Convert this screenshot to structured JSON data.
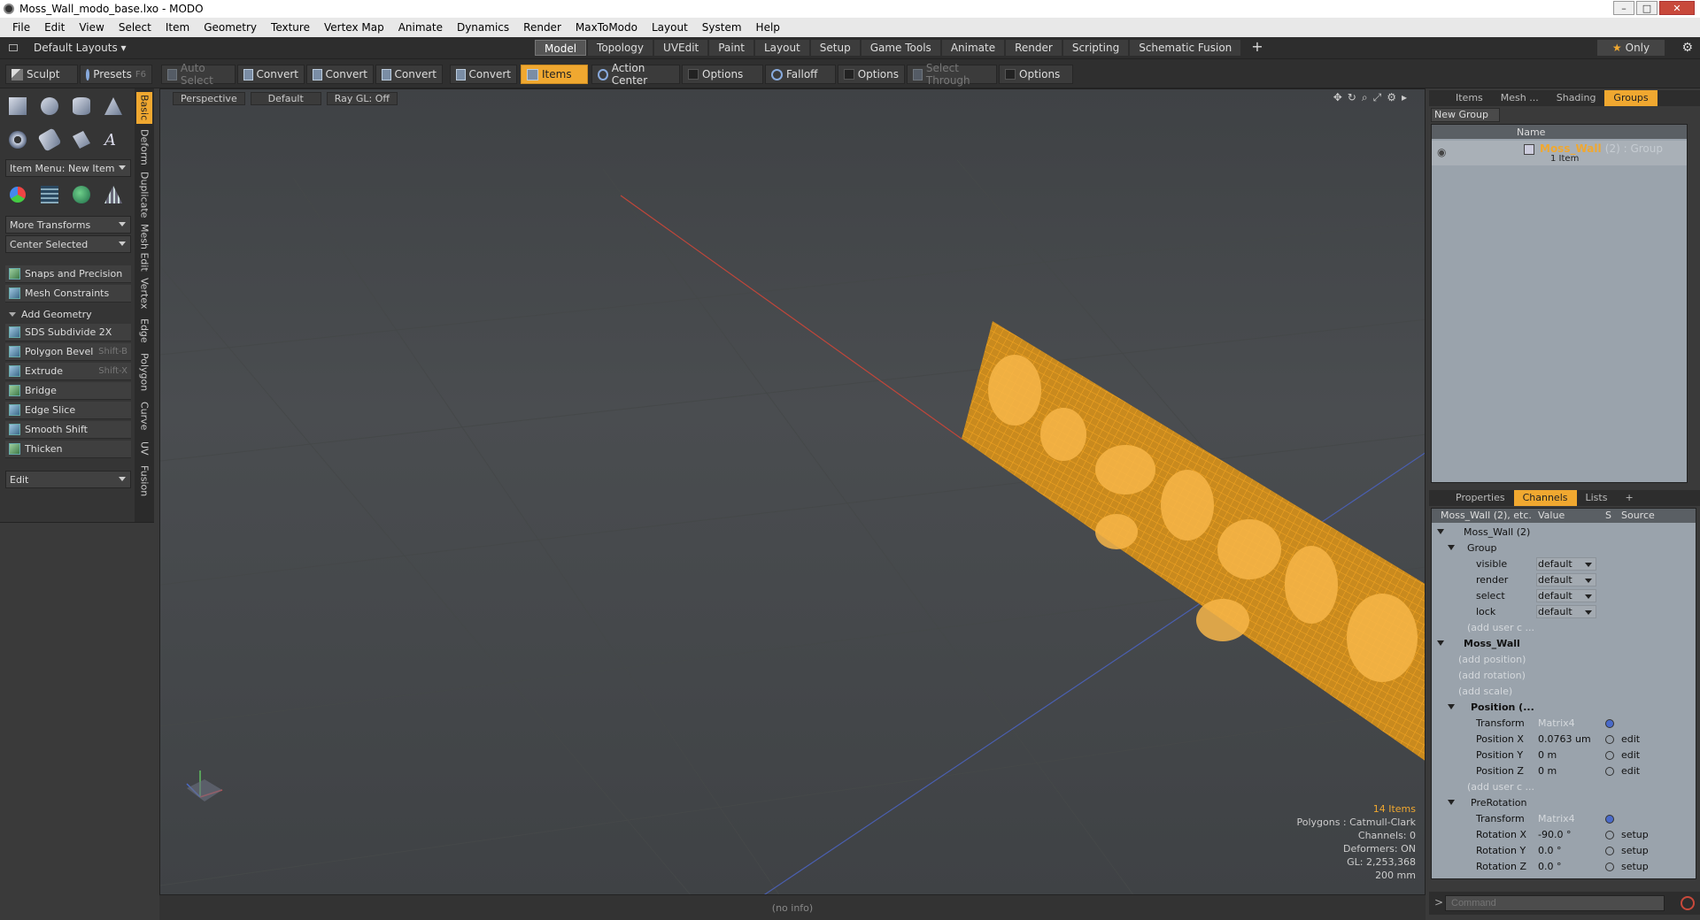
{
  "window": {
    "title": "Moss_Wall_modo_base.lxo - MODO"
  },
  "menu": [
    "File",
    "Edit",
    "View",
    "Select",
    "Item",
    "Geometry",
    "Texture",
    "Vertex Map",
    "Animate",
    "Dynamics",
    "Render",
    "MaxToModo",
    "Layout",
    "System",
    "Help"
  ],
  "layout": {
    "default_label": "Default Layouts ▾",
    "tabs": [
      "Model",
      "Topology",
      "UVEdit",
      "Paint",
      "Layout",
      "Setup",
      "Game Tools",
      "Animate",
      "Render",
      "Scripting",
      "Schematic Fusion",
      "+"
    ],
    "active_tab": "Model",
    "only_label": "Only"
  },
  "toolbar": {
    "sculpt": "Sculpt",
    "presets": "Presets",
    "presets_key": "F6",
    "auto_select": "Auto Select",
    "convert1": "Convert",
    "convert2": "Convert",
    "convert3": "Convert",
    "convert4": "Convert",
    "items": "Items",
    "action_center": "Action Center",
    "options1": "Options",
    "falloff": "Falloff",
    "options2": "Options",
    "select_through": "Select Through",
    "options3": "Options"
  },
  "side_tabs": [
    "Basic",
    "Deform",
    "Duplicate",
    "Mesh Edit",
    "Vertex",
    "Edge",
    "Polygon",
    "Curve",
    "UV",
    "Fusion"
  ],
  "left": {
    "item_menu": "Item Menu: New Item",
    "more_transforms": "More Transforms",
    "center_selected": "Center Selected",
    "snaps": "Snaps and Precision",
    "mesh_constraints": "Mesh Constraints",
    "add_geometry": "Add Geometry",
    "tools": [
      {
        "label": "SDS Subdivide 2X",
        "key": ""
      },
      {
        "label": "Polygon Bevel",
        "key": "Shift-B"
      },
      {
        "label": "Extrude",
        "key": "Shift-X"
      },
      {
        "label": "Bridge",
        "key": ""
      },
      {
        "label": "Edge Slice",
        "key": ""
      },
      {
        "label": "Smooth Shift",
        "key": ""
      },
      {
        "label": "Thicken",
        "key": ""
      }
    ],
    "edit": "Edit"
  },
  "viewport": {
    "view": "Perspective",
    "shading": "Default",
    "raygl": "Ray GL: Off",
    "stats": {
      "items": "14 Items",
      "polygons": "Polygons : Catmull-Clark",
      "channels": "Channels: 0",
      "deformers": "Deformers: ON",
      "gl": "GL: 2,253,368",
      "scale": "200 mm"
    },
    "status": "(no info)"
  },
  "right": {
    "top_tabs": [
      "Items",
      "Mesh ...",
      "Shading",
      "Groups"
    ],
    "active_top_tab": "Groups",
    "new_group": "New Group",
    "group_header": "Name",
    "group_name": "Moss_Wall",
    "group_suffix": "(2) : Group",
    "group_sub": "1 Item",
    "bottom_tabs": [
      "Properties",
      "Channels",
      "Lists",
      "+"
    ],
    "active_bottom_tab": "Channels",
    "chan_header": {
      "name": "Moss_Wall (2), etc.",
      "value": "Value",
      "s": "S",
      "source": "Source"
    },
    "channels": [
      {
        "label": "Moss_Wall (2)",
        "value": "",
        "src": ""
      },
      {
        "label": "Group",
        "value": "",
        "src": ""
      },
      {
        "label": "visible",
        "value": "default",
        "src": ""
      },
      {
        "label": "render",
        "value": "default",
        "src": ""
      },
      {
        "label": "select",
        "value": "default",
        "src": ""
      },
      {
        "label": "lock",
        "value": "default",
        "src": ""
      },
      {
        "label": "(add user c ...",
        "value": "",
        "src": ""
      },
      {
        "label": "Moss_Wall",
        "value": "",
        "src": ""
      },
      {
        "label": "(add position)",
        "value": "",
        "src": ""
      },
      {
        "label": "(add rotation)",
        "value": "",
        "src": ""
      },
      {
        "label": "(add scale)",
        "value": "",
        "src": ""
      },
      {
        "label": "Position (...",
        "value": "",
        "src": ""
      },
      {
        "label": "Transform",
        "value": "Matrix4",
        "src": ""
      },
      {
        "label": "Position X",
        "value": "0.0763 um",
        "src": "edit"
      },
      {
        "label": "Position Y",
        "value": "0 m",
        "src": "edit"
      },
      {
        "label": "Position Z",
        "value": "0 m",
        "src": "edit"
      },
      {
        "label": "(add user c ...",
        "value": "",
        "src": ""
      },
      {
        "label": "PreRotation",
        "value": "",
        "src": ""
      },
      {
        "label": "Transform",
        "value": "Matrix4",
        "src": ""
      },
      {
        "label": "Rotation X",
        "value": "-90.0 °",
        "src": "setup"
      },
      {
        "label": "Rotation Y",
        "value": "0.0 °",
        "src": "setup"
      },
      {
        "label": "Rotation Z",
        "value": "0.0 °",
        "src": "setup"
      }
    ],
    "command_placeholder": "Command"
  },
  "colors": {
    "accent": "#f0a830",
    "mesh": "#f5a623"
  }
}
